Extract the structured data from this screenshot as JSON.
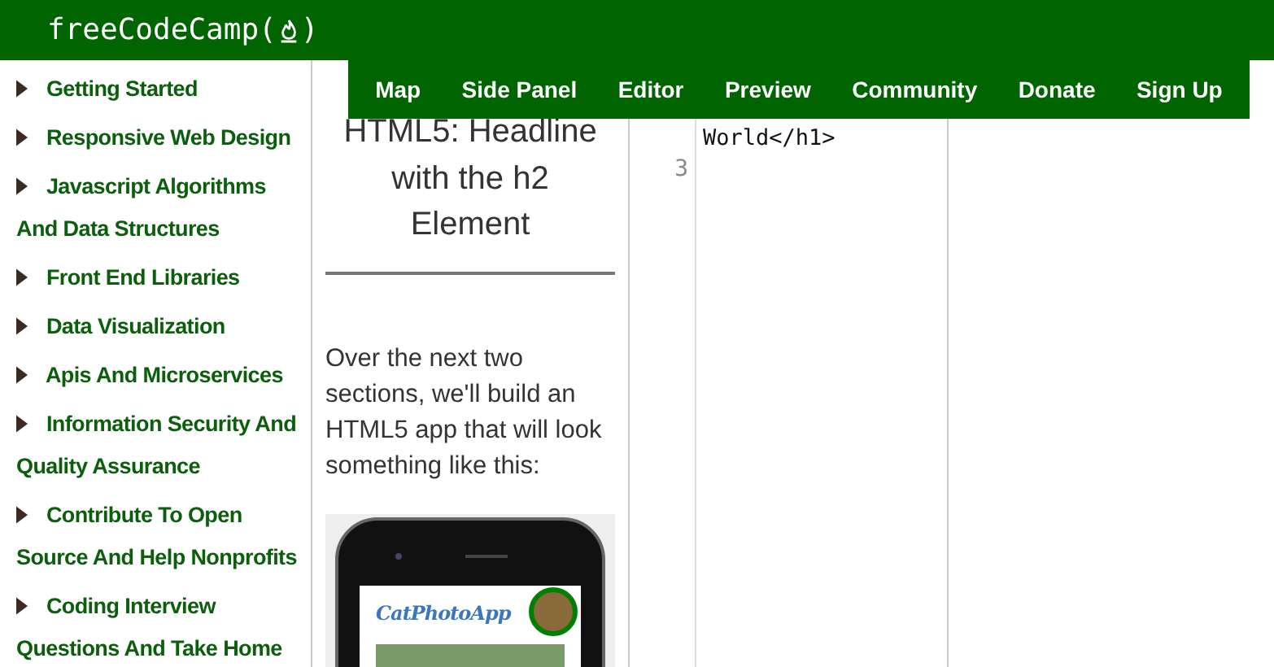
{
  "header": {
    "logo": "freeCodeCamp(",
    "logo_end": ")"
  },
  "nav": [
    {
      "label": "Map"
    },
    {
      "label": "Side Panel"
    },
    {
      "label": "Editor"
    },
    {
      "label": "Preview"
    },
    {
      "label": "Community"
    },
    {
      "label": "Donate"
    },
    {
      "label": "Sign Up"
    }
  ],
  "sidebar": {
    "items": [
      {
        "label": "Getting Started",
        "expanded": false
      },
      {
        "label": "Responsive Web Design",
        "expanded": false
      },
      {
        "label": "Javascript Algorithms And Data Structures",
        "expanded": false
      },
      {
        "label": "Front End Libraries",
        "expanded": false
      },
      {
        "label": "Data Visualization",
        "expanded": false
      },
      {
        "label": "Apis And Microservices",
        "expanded": false
      },
      {
        "label": "Information Security And Quality Assurance",
        "expanded": false
      },
      {
        "label": "Contribute To Open Source And Help Nonprofits",
        "expanded": false
      },
      {
        "label": "Coding Interview Questions And Take Home",
        "expanded": false
      }
    ]
  },
  "challenge": {
    "title": "HTML5: Headline with the h2 Element",
    "description": "Over the next two sections, we'll build an HTML5 app that will look something like this:",
    "example_app_title": "CatPhotoApp"
  },
  "editor": {
    "lines": [
      {
        "text": "World</h1>"
      },
      {
        "number": "3"
      }
    ]
  }
}
